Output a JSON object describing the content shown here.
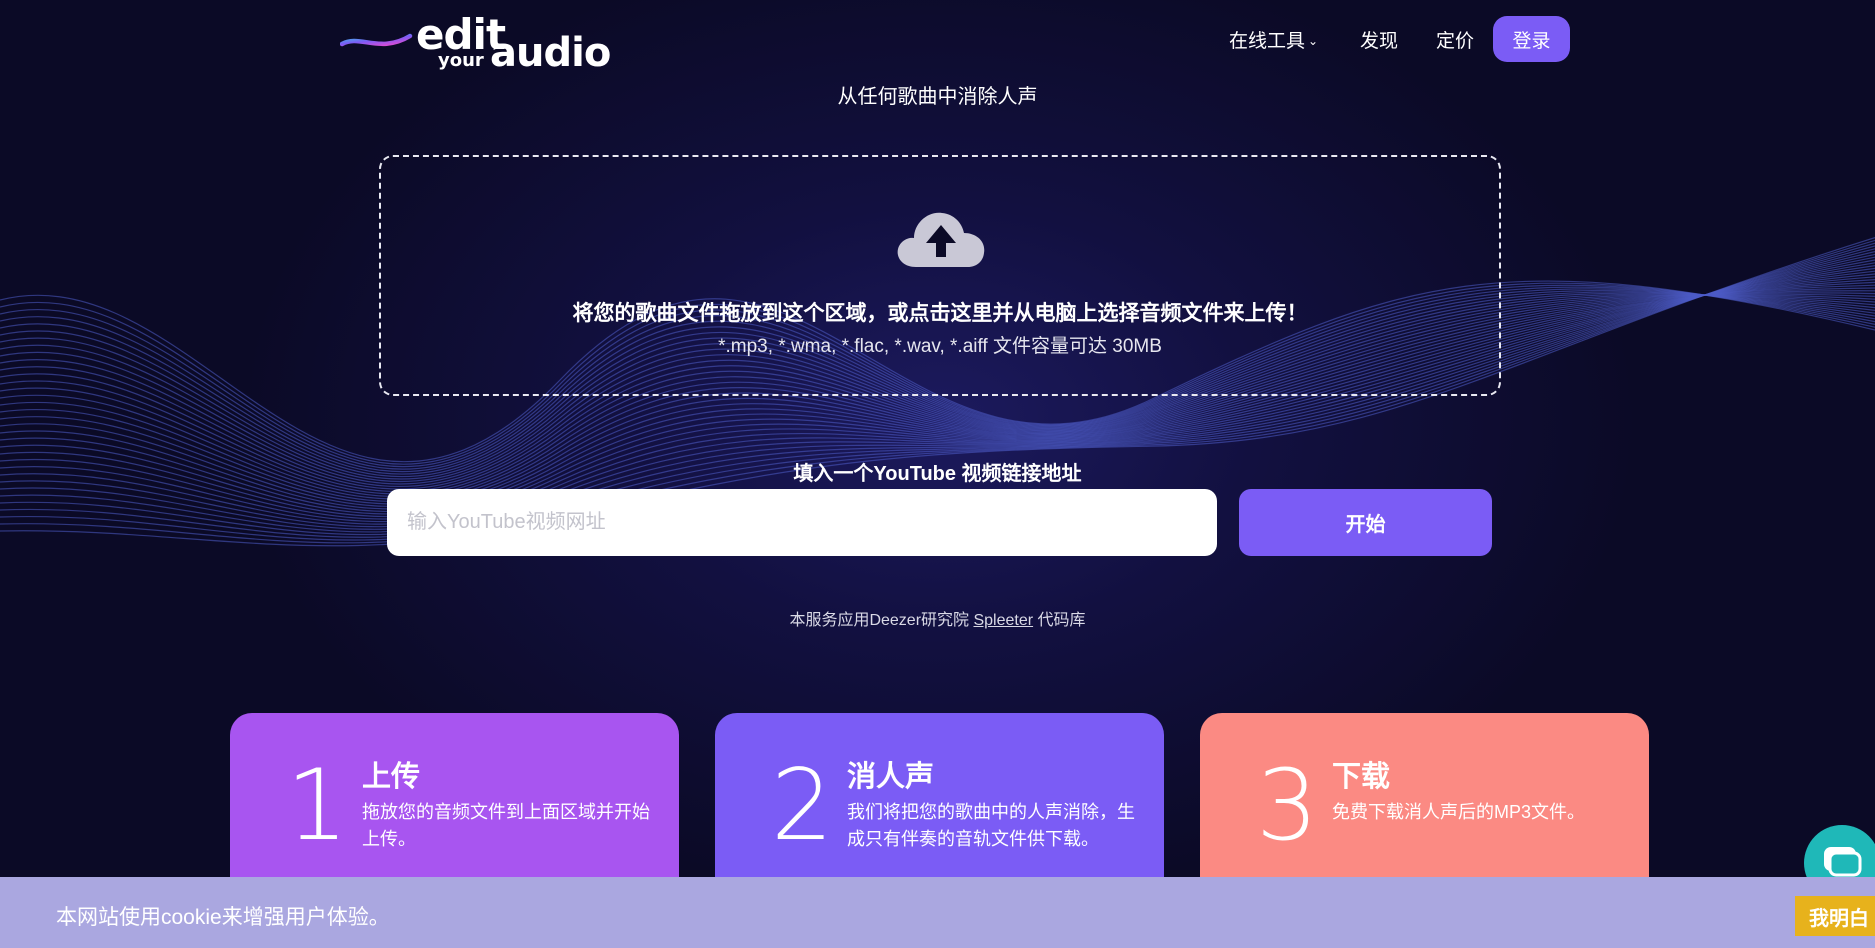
{
  "header": {
    "logo": {
      "edit": "edit",
      "your": "your",
      "audio": "audio"
    },
    "nav": [
      {
        "label": "在线工具",
        "has_dropdown": true
      },
      {
        "label": "发现"
      },
      {
        "label": "定价"
      }
    ],
    "login_label": "登录"
  },
  "hero": {
    "subtitle": "从任何歌曲中消除人声"
  },
  "dropzone": {
    "icon": "cloud-upload-icon",
    "main_text": "将您的歌曲文件拖放到这个区域，或点击这里并从电脑上选择音频文件来上传！",
    "formats_text": "*.mp3, *.wma, *.flac, *.wav, *.aiff 文件容量可达 30MB"
  },
  "youtube": {
    "label": "填入一个YouTube 视频链接地址",
    "placeholder": "输入YouTube视频网址",
    "value": "",
    "start_label": "开始"
  },
  "credit": {
    "prefix": "本服务应用Deezer研究院 ",
    "link": "Spleeter",
    "suffix": " 代码库"
  },
  "steps": [
    {
      "number": "1",
      "title": "上传",
      "desc": "拖放您的音频文件到上面区域并开始上传。",
      "color": "#a855f0"
    },
    {
      "number": "2",
      "title": "消人声",
      "desc": "我们将把您的歌曲中的人声消除，生成只有伴奏的音轨文件供下载。",
      "color": "#7b5cf5"
    },
    {
      "number": "3",
      "title": "下载",
      "desc": "免费下载消人声后的MP3文件。",
      "color": "#fb8a83"
    }
  ],
  "cookie": {
    "text": "本网站使用cookie来增强用户体验。",
    "accept_label": "我明白"
  },
  "chat": {
    "icon": "chat-bubble-icon"
  },
  "colors": {
    "background": "#0b0a26",
    "accent": "#7b5cf5",
    "cookie_bar": "#aaa7e0",
    "cookie_button": "#e7b21c",
    "chat": "#1fb8b8"
  }
}
